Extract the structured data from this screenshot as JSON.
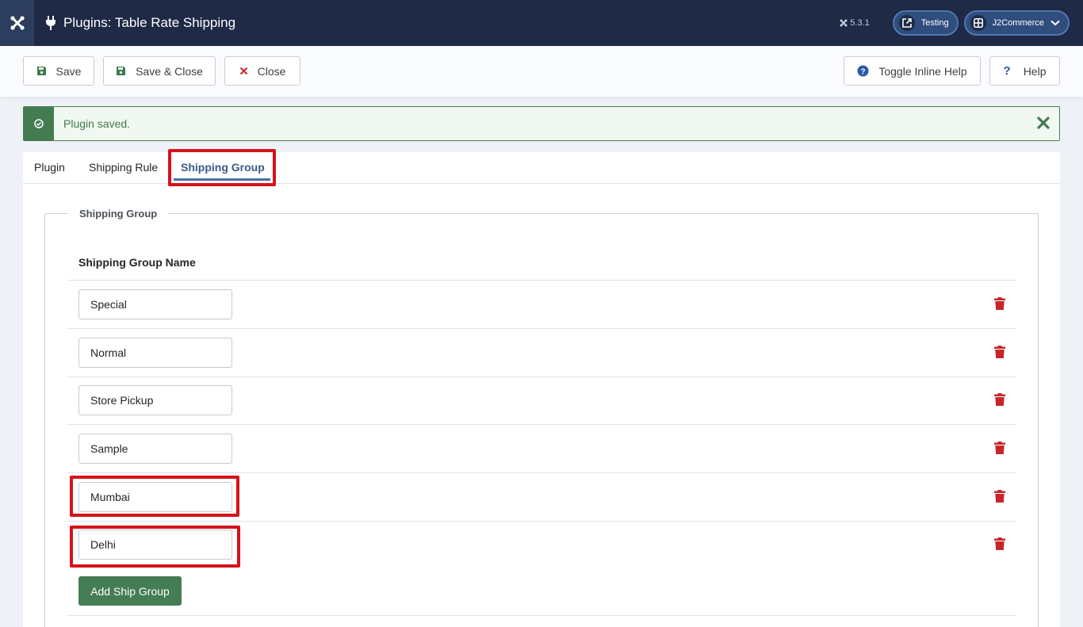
{
  "header": {
    "title": "Plugins: Table Rate Shipping",
    "version": "5.3.1",
    "site_pill": "Testing",
    "user_pill": "J2Commerce"
  },
  "toolbar": {
    "save": "Save",
    "save_close": "Save & Close",
    "close": "Close",
    "toggle_help": "Toggle Inline Help",
    "help": "Help"
  },
  "alert": {
    "message": "Plugin saved."
  },
  "tabs": [
    {
      "label": "Plugin"
    },
    {
      "label": "Shipping Rule"
    },
    {
      "label": "Shipping Group"
    }
  ],
  "fieldset": {
    "legend": "Shipping Group",
    "column_header": "Shipping Group Name",
    "rows": [
      {
        "value": "Special"
      },
      {
        "value": "Normal"
      },
      {
        "value": "Store Pickup"
      },
      {
        "value": "Sample"
      },
      {
        "value": "Mumbai"
      },
      {
        "value": "Delhi"
      }
    ],
    "add_button": "Add Ship Group"
  },
  "colors": {
    "header_bg": "#1e2a46",
    "success": "#457d54",
    "danger": "#c5262b",
    "active_tab": "#3c5a86",
    "highlight": "#d6121a"
  }
}
